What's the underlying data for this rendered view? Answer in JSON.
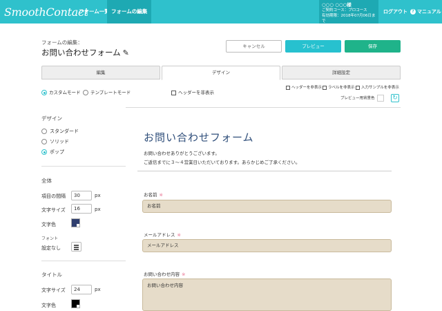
{
  "header": {
    "logo": "SmoothContact",
    "nav": [
      "フォーム一覧",
      "フォームの編集"
    ],
    "user": {
      "name": "○○○ ○○○様",
      "plan": "ご契約コース：プロコース",
      "expiry": "有効期限：2018年07月06日まで"
    },
    "logout": "ログアウト",
    "manual": "マニュアル"
  },
  "page": {
    "crumb": "フォームの編集：",
    "title": "お問い合わせフォーム",
    "buttons": {
      "cancel": "キャンセル",
      "preview": "プレビュー",
      "save": "保存"
    }
  },
  "tabs": [
    "編集",
    "デザイン",
    "詳細設定"
  ],
  "mode": {
    "custom": "カスタムモード",
    "template": "テンプレートモード",
    "hide_header": "ヘッダーを非表示",
    "opts": [
      "ヘッダーを非表示",
      "ラベルを非表示",
      "入力サンプルを非表示"
    ],
    "bg_label": "プレビュー用背景色"
  },
  "sidebar": {
    "design_heading": "デザイン",
    "design_options": [
      "スタンダード",
      "ソリッド",
      "ポップ"
    ],
    "general_heading": "全体",
    "spacing_label": "項目の間隔",
    "spacing_value": "30",
    "fontsize_label": "文字サイズ",
    "fontsize_value": "16",
    "color_label": "文字色",
    "general_color": "#2f3e6e",
    "font_label": "フォント",
    "font_value": "設定なし",
    "title_heading": "タイトル",
    "title_fontsize_label": "文字サイズ",
    "title_fontsize_value": "24",
    "title_color_label": "文字色",
    "title_color": "#000000",
    "unit": "px"
  },
  "preview": {
    "title": "お問い合わせフォーム",
    "desc1": "お問い合わせありがとうございます。",
    "desc2": "ご返信までに３～４営業日いただいております。あらかじめご了承ください。",
    "fields": [
      {
        "label": "お名前",
        "placeholder": "お名前"
      },
      {
        "label": "メールアドレス",
        "placeholder": "メールアドレス"
      },
      {
        "label": "お問い合わせ内容",
        "placeholder": "お問い合わせ内容"
      }
    ],
    "required_mark": "※"
  }
}
